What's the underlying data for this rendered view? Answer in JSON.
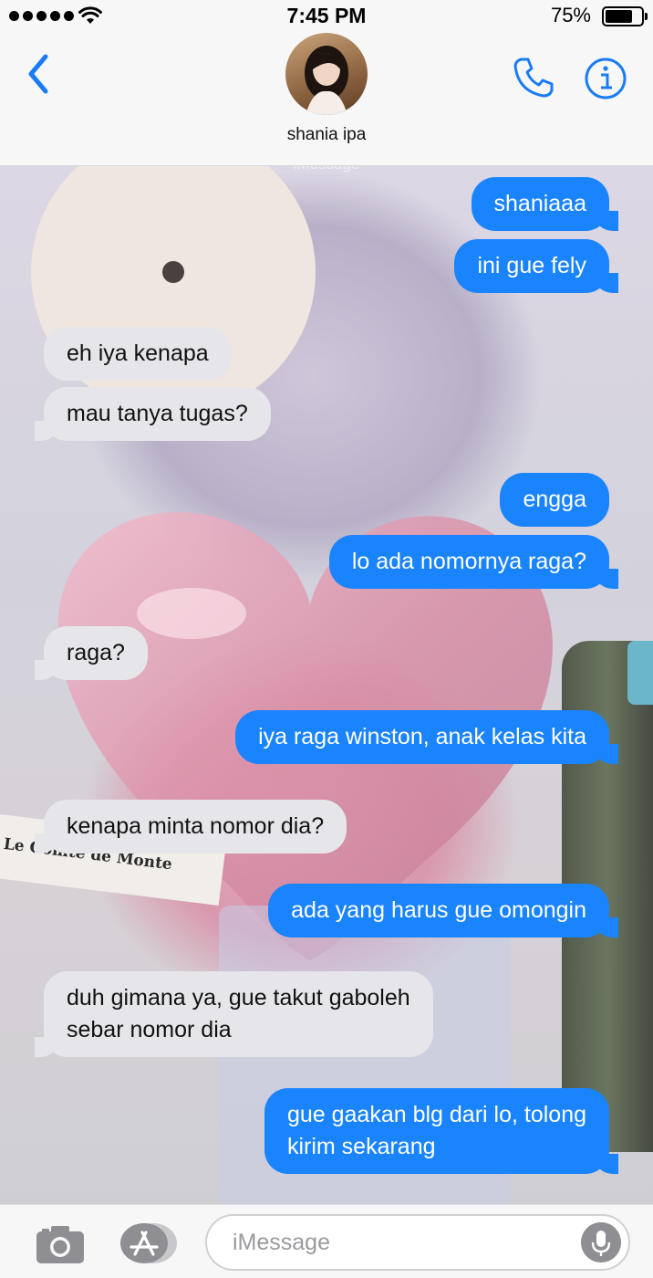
{
  "status_bar": {
    "time": "7:45 PM",
    "battery_percent": "75%",
    "battery_level": 0.75,
    "signal_bars": 5,
    "icons": [
      "signal-dots-icon",
      "wifi-icon",
      "battery-icon"
    ]
  },
  "header": {
    "contact_name": "shania ipa",
    "icons": [
      "back-chevron-icon",
      "phone-icon",
      "info-icon"
    ]
  },
  "chat": {
    "watermark": "iMessage",
    "wallpaper_text": "Le Comte de Monte",
    "messages": [
      {
        "direction": "out",
        "text": "shaniaaa"
      },
      {
        "direction": "out",
        "text": "ini gue fely"
      },
      {
        "direction": "in",
        "text": "eh iya kenapa"
      },
      {
        "direction": "in",
        "text": "mau tanya tugas?"
      },
      {
        "direction": "out",
        "text": "engga"
      },
      {
        "direction": "out",
        "text": "lo ada nomornya raga?"
      },
      {
        "direction": "in",
        "text": "raga?"
      },
      {
        "direction": "out",
        "text": "iya raga winston, anak kelas kita"
      },
      {
        "direction": "in",
        "text": "kenapa minta nomor dia?"
      },
      {
        "direction": "out",
        "text": "ada yang harus gue omongin"
      },
      {
        "direction": "in",
        "text": "duh gimana ya, gue takut gaboleh\nsebar nomor dia"
      },
      {
        "direction": "out",
        "text": "gue gaakan blg dari lo, tolong\nkirim sekarang"
      }
    ]
  },
  "input_bar": {
    "placeholder": "iMessage",
    "icons": [
      "camera-icon",
      "app-store-icon",
      "microphone-icon"
    ]
  },
  "colors": {
    "outgoing_bubble": "#1a84ff",
    "incoming_bubble": "#e6e6ea",
    "accent": "#1a7cf5"
  }
}
